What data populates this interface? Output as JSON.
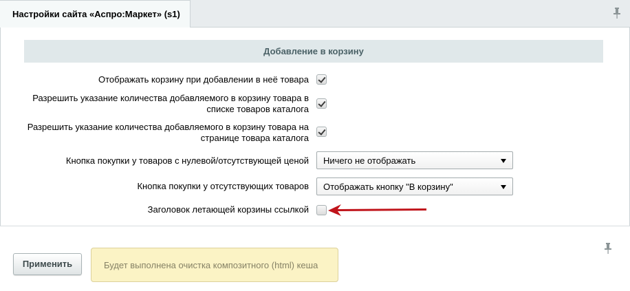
{
  "tab": {
    "title": "Настройки сайта «Аспро:Маркет» (s1)"
  },
  "section": {
    "title": "Добавление в корзину"
  },
  "rows": [
    {
      "label_lines": [
        "Отображать корзину при добавлении в неё товара"
      ],
      "checked": true
    },
    {
      "label_lines": [
        "Разрешить указание количества добавляемого в корзину товара в",
        "списке товаров каталога"
      ],
      "checked": true
    },
    {
      "label_lines": [
        "Разрешить указание количества добавляемого в корзину товара на",
        "странице товара каталога"
      ],
      "checked": true
    },
    {
      "label_lines": [
        "Кнопка покупки у товаров с нулевой/отсутствующей ценой"
      ],
      "selected": "Ничего не отображать"
    },
    {
      "label_lines": [
        "Кнопка покупки у отсутствующих товаров"
      ],
      "selected": "Отображать кнопку \"В корзину\""
    },
    {
      "label_lines": [
        "Заголовок летающей корзины ссылкой"
      ],
      "checked": false
    }
  ],
  "footer": {
    "apply_label": "Применить",
    "notice": "Будет выполнена очистка композитного (html) кеша"
  },
  "icons": {
    "pin": "pin-icon",
    "arrow": "red-arrow-annotation",
    "check": "checkmark-icon",
    "dropdown": "chevron-down-icon"
  },
  "colors": {
    "annotation_arrow": "#c0141b",
    "notice_bg": "#fbf3c5",
    "section_bg": "#e0e8ea"
  }
}
